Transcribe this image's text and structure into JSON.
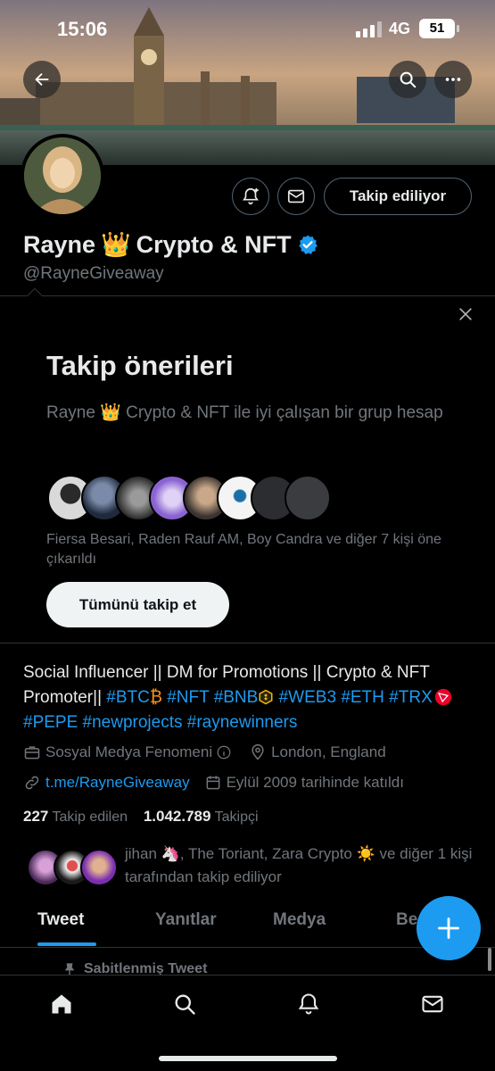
{
  "status_bar": {
    "time": "15:06",
    "network": "4G",
    "battery": "51"
  },
  "profile": {
    "name": "Rayne",
    "name_emoji": "👑",
    "name_rest": "Crypto & NFT",
    "handle": "@RayneGiveaway",
    "following_button": "Takip ediliyor"
  },
  "suggestions": {
    "title": "Takip önerileri",
    "description": "Rayne 👑 Crypto & NFT ile iyi çalışan bir grup hesap",
    "highlighted": "Fiersa Besari, Raden Rauf AM, Boy Candra ve diğer 7 kişi öne çıkarıldı",
    "follow_all": "Tümünü takip et"
  },
  "bio": {
    "text_1": "Social Influencer || DM for Promotions || Crypto & NFT Promoter||",
    "tag_btc": "#BTC",
    "emoji_btc": "₿",
    "tag_nft": "#NFT",
    "tag_bnb": "#BNB",
    "tag_web3": "#WEB3",
    "tag_eth": "#ETH",
    "tag_trx": "#TRX",
    "tag_pepe": "#PEPE",
    "tag_newprojects": "#newprojects",
    "tag_raynewinners": "#raynewinners"
  },
  "meta": {
    "category": "Sosyal Medya Fenomeni",
    "location": "London, England",
    "link": "t.me/RayneGiveaway",
    "joined": "Eylül 2009 tarihinde katıldı"
  },
  "counts": {
    "following_count": "227",
    "following_label": "Takip edilen",
    "followers_count": "1.042.789",
    "followers_label": "Takipçi"
  },
  "followed_by": {
    "text": "jihan 🦄, The Toriant, Zara Crypto ☀️ ve diğer 1 kişi tarafından takip ediliyor"
  },
  "tabs": [
    {
      "label": "Tweet"
    },
    {
      "label": "Yanıtlar"
    },
    {
      "label": "Medya"
    },
    {
      "label": "Be"
    }
  ],
  "pinned": {
    "label": "Sabitlenmiş Tweet"
  },
  "colors": {
    "accent": "#1d9bf0",
    "background": "#000000",
    "muted": "#71767b",
    "text": "#e7e9ea"
  },
  "icons": {
    "back": "arrow-left-icon",
    "search": "search-icon",
    "more": "more-icon",
    "notify": "bell-plus-icon",
    "mail": "mail-icon",
    "verified": "verified-badge-icon",
    "close": "close-icon",
    "briefcase": "briefcase-icon",
    "info": "info-icon",
    "location": "location-pin-icon",
    "link": "link-icon",
    "calendar": "calendar-icon",
    "compose": "plus-icon",
    "home": "home-icon",
    "nav_search": "search-icon",
    "notifications": "bell-icon",
    "messages": "mail-icon",
    "pin": "pin-icon"
  }
}
